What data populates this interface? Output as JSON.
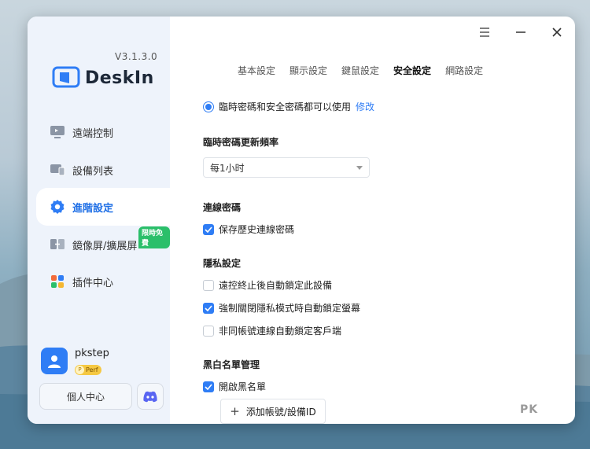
{
  "app": {
    "version": "V3.1.3.0",
    "name": "DeskIn",
    "accent_color": "#2f7df5"
  },
  "window_controls": [
    "menu-icon",
    "minimize-icon",
    "close-icon"
  ],
  "sidebar": {
    "items": [
      {
        "label": "遠端控制",
        "icon": "remote-control-icon",
        "active": false
      },
      {
        "label": "設備列表",
        "icon": "device-list-icon",
        "active": false
      },
      {
        "label": "進階設定",
        "icon": "gear-icon",
        "active": true
      },
      {
        "label": "鏡像屏/擴展屏",
        "icon": "screen-mirror-icon",
        "active": false,
        "badge": "限時免費"
      },
      {
        "label": "插件中心",
        "icon": "plugin-icon",
        "active": false
      }
    ],
    "user": {
      "name": "pkstep",
      "badge_letter": "P",
      "badge_label": "Perf"
    },
    "user_center_label": "個人中心",
    "discord_icon": "discord-icon"
  },
  "tabs": [
    {
      "label": "基本設定",
      "active": false
    },
    {
      "label": "顯示設定",
      "active": false
    },
    {
      "label": "鍵鼠設定",
      "active": false
    },
    {
      "label": "安全設定",
      "active": true
    },
    {
      "label": "網路設定",
      "active": false
    }
  ],
  "security": {
    "password_mode": {
      "label": "臨時密碼和安全密碼都可以使用",
      "edit_label": "修改"
    },
    "temp_password_refresh": {
      "title": "臨時密碼更新頻率",
      "selected": "每1小时"
    },
    "connection_password": {
      "title": "連線密碼",
      "save_history": {
        "label": "保存歷史連線密碼",
        "checked": true
      }
    },
    "privacy": {
      "title": "隱私設定",
      "options": [
        {
          "label": "遠控終止後自動鎖定此設備",
          "checked": false
        },
        {
          "label": "強制關閉隱私模式時自動鎖定螢幕",
          "checked": true
        },
        {
          "label": "非同帳號連線自動鎖定客戶端",
          "checked": false
        }
      ]
    },
    "blacklist": {
      "title": "黑白名單管理",
      "enable": {
        "label": "開啟黑名單",
        "checked": true
      },
      "add_label": "添加帳號/設備ID"
    }
  },
  "watermark": "PK"
}
